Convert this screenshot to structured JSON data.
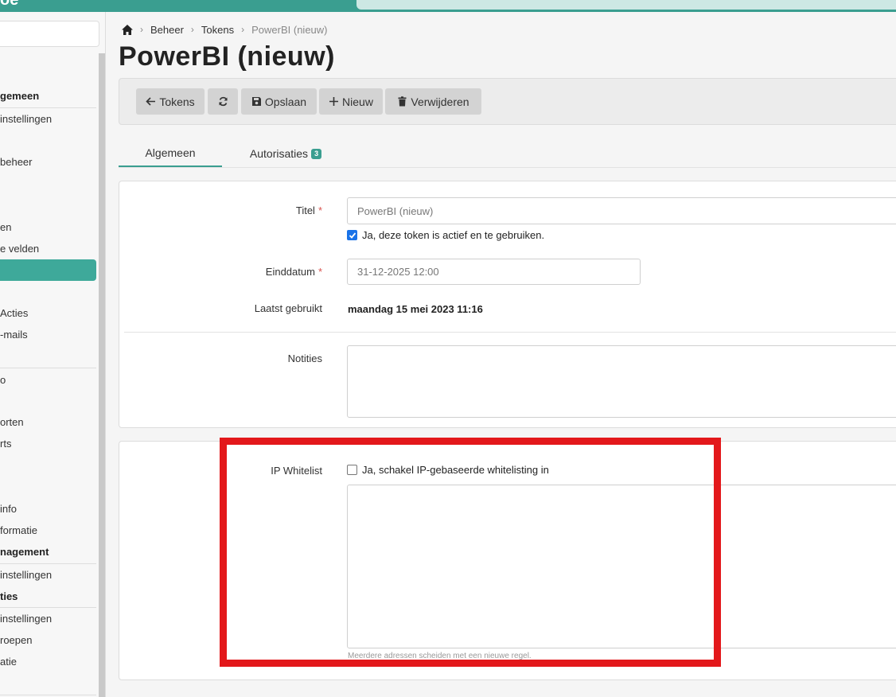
{
  "app": {
    "logo_text": "oe"
  },
  "sidebar": {
    "items": [
      {
        "label": "gemeen",
        "type": "head"
      },
      {
        "label": "instellingen",
        "type": "item"
      },
      {
        "label": "beheer",
        "type": "item"
      },
      {
        "label": "en",
        "type": "item"
      },
      {
        "label": "e velden",
        "type": "item"
      },
      {
        "label": "Acties",
        "type": "item"
      },
      {
        "label": "-mails",
        "type": "item"
      },
      {
        "label": "o",
        "type": "item"
      },
      {
        "label": "orten",
        "type": "item"
      },
      {
        "label": "rts",
        "type": "item"
      },
      {
        "label": "info",
        "type": "item"
      },
      {
        "label": "formatie",
        "type": "item"
      },
      {
        "label": "nagement",
        "type": "head"
      },
      {
        "label": "instellingen",
        "type": "item"
      },
      {
        "label": "ties",
        "type": "head"
      },
      {
        "label": "instellingen",
        "type": "item"
      },
      {
        "label": "roepen",
        "type": "item"
      },
      {
        "label": "atie",
        "type": "item"
      }
    ]
  },
  "breadcrumb": {
    "items": [
      "Beheer",
      "Tokens"
    ],
    "current": "PowerBI (nieuw)"
  },
  "page": {
    "title": "PowerBI (nieuw)"
  },
  "toolbar": {
    "back_label": "Tokens",
    "save_label": "Opslaan",
    "new_label": "Nieuw",
    "delete_label": "Verwijderen"
  },
  "tabs": {
    "general": "Algemeen",
    "authorizations": "Autorisaties",
    "authorizations_count": "3"
  },
  "form": {
    "title_label": "Titel",
    "title_placeholder": "PowerBI (nieuw)",
    "active_checkbox_label": "Ja, deze token is actief en te gebruiken.",
    "active_checked": true,
    "enddate_label": "Einddatum",
    "enddate_value": "31-12-2025 12:00",
    "last_used_label": "Laatst gebruikt",
    "last_used_value": "maandag 15 mei 2023 11:16",
    "notes_label": "Notities",
    "required_mark": "*"
  },
  "whitelist": {
    "label": "IP Whitelist",
    "checkbox_label": "Ja, schakel IP-gebaseerde whitelisting in",
    "checked": false,
    "help_text": "Meerdere adressen scheiden met een nieuwe regel."
  },
  "colors": {
    "accent": "#3a9e90",
    "highlight": "#e3181b",
    "checkbox_checked": "#1a73e8"
  }
}
